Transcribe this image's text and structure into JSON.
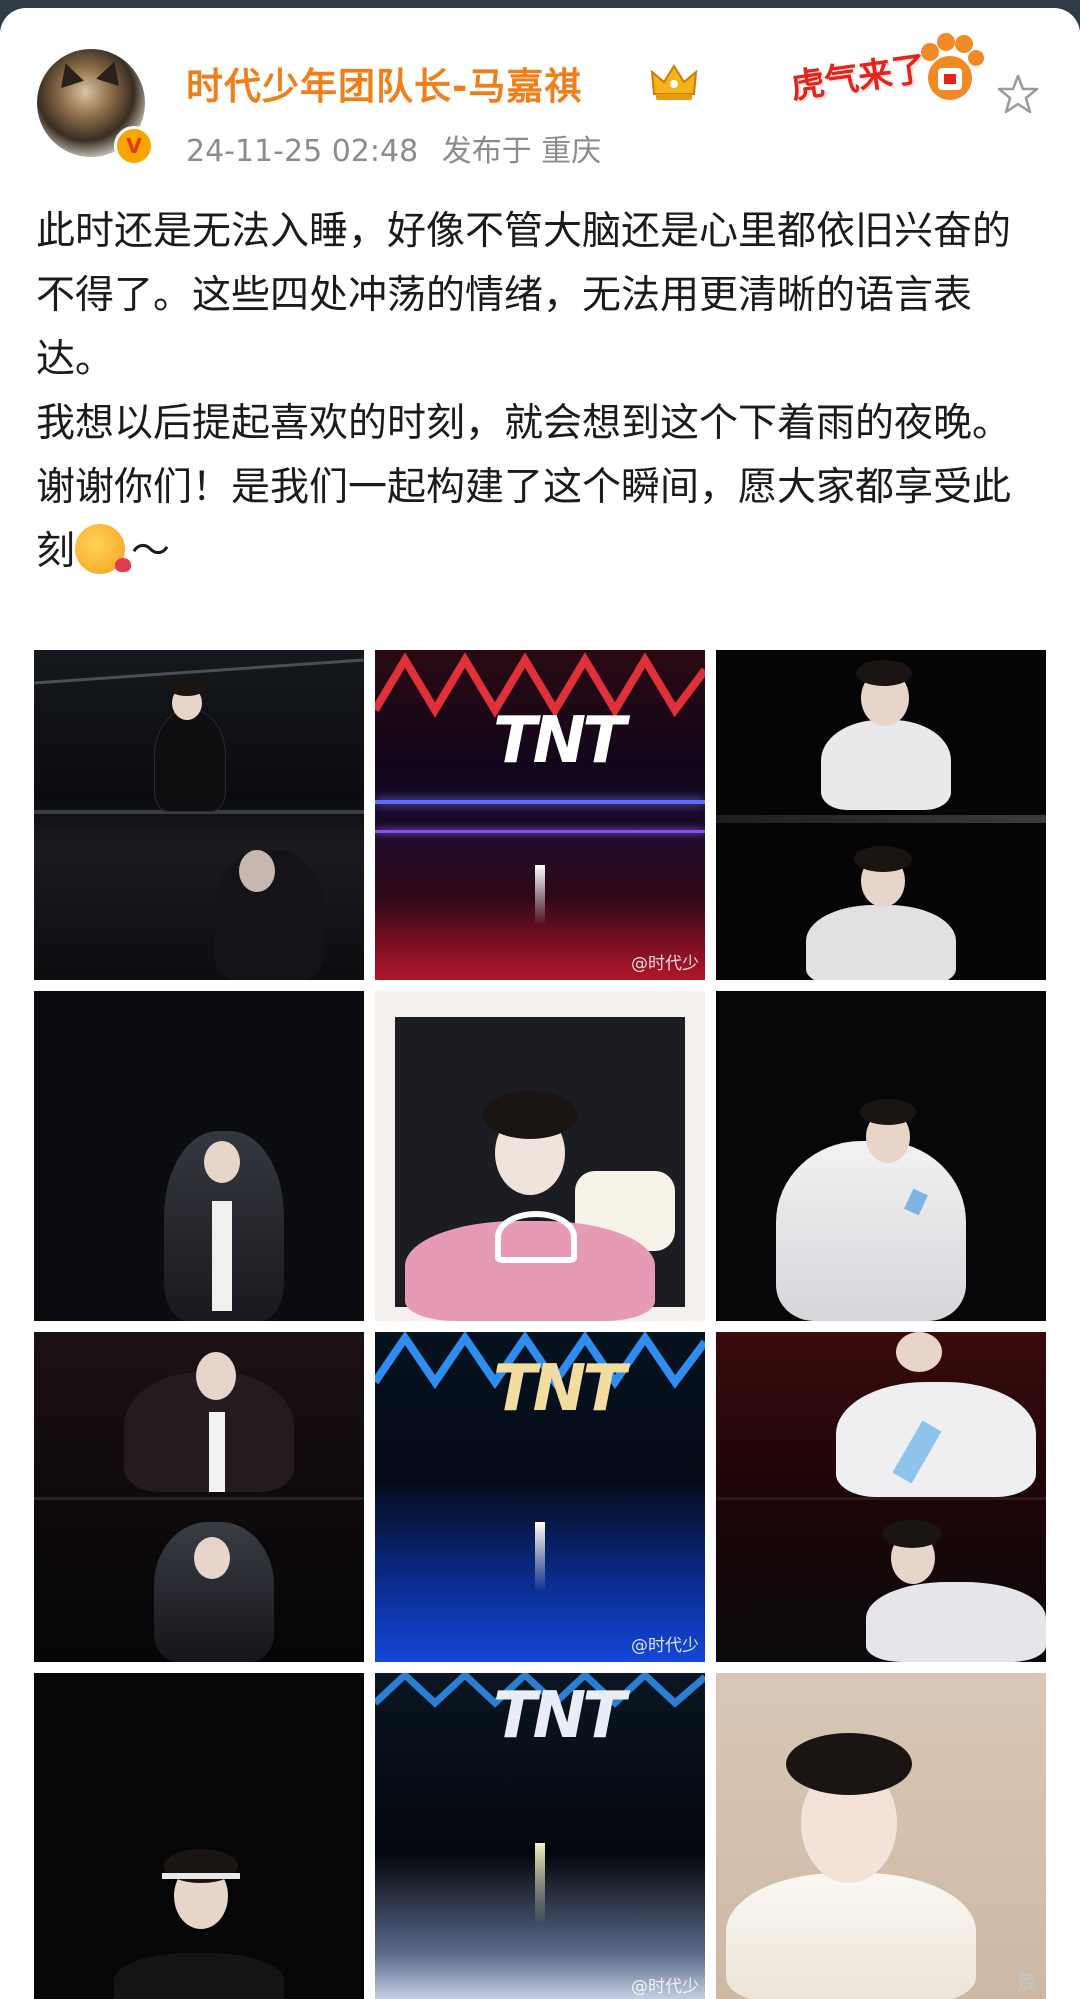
{
  "post": {
    "username": "时代少年团队长-马嘉祺",
    "timestamp": "24-11-25 02:48",
    "location": "发布于 重庆",
    "sticker_text": "虎气来了",
    "badge_icon": "crown-icon",
    "paragraphs": [
      "此时还是无法入睡，好像不管大脑还是心里都依旧兴奋的不得了。这些四处冲荡的情绪，无法用更清晰的语言表达。",
      "我想以后提起喜欢的时刻，就会想到这个下着雨的夜晚。",
      "谢谢你们！是我们一起构建了这个瞬间，愿大家都享受此刻"
    ],
    "tail": "～"
  },
  "images": {
    "logo": "TNT",
    "watermark": "@时代少",
    "page_watermark": "景"
  },
  "colors": {
    "username": "#f07f1a",
    "meta": "#8c8c8c",
    "text": "#1b1b1b",
    "sticker": "#e2241d"
  }
}
